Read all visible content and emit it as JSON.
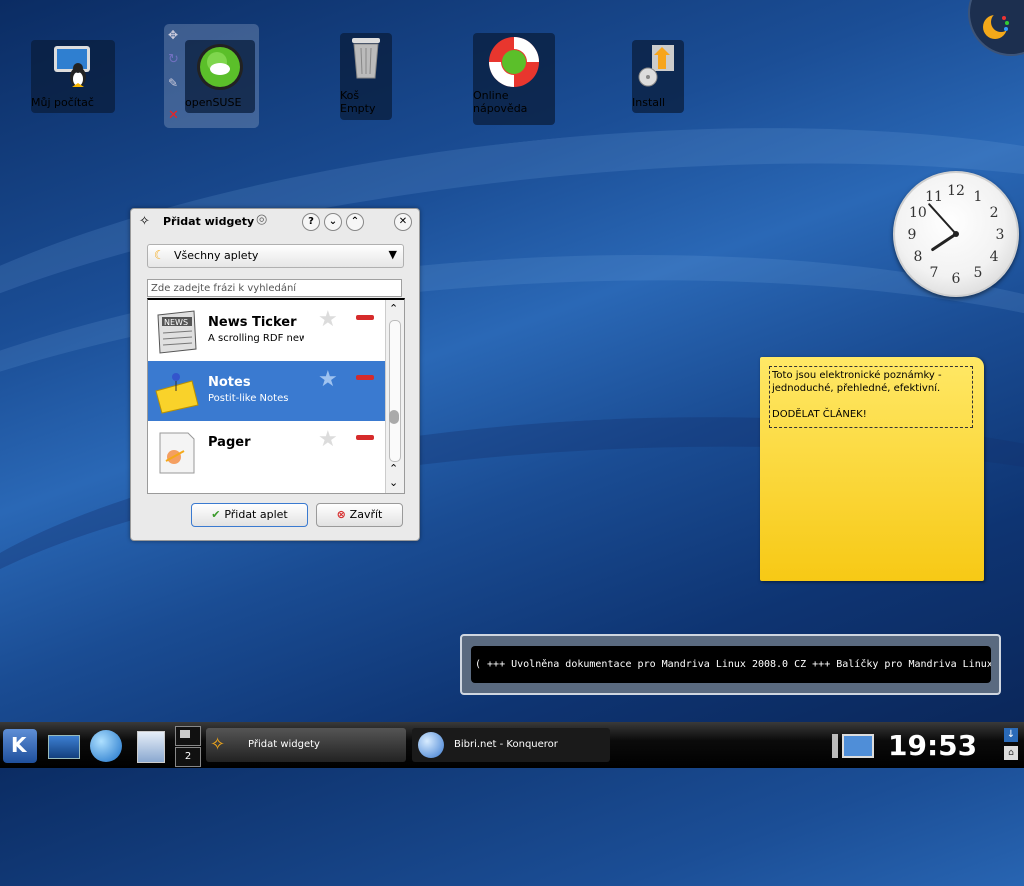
{
  "desktop_icons": [
    {
      "label": "Můj počítač",
      "icon": "my-computer-icon"
    },
    {
      "label": "openSUSE",
      "icon": "opensuse-icon"
    },
    {
      "label_line1": "Koš",
      "label_line2": "Empty",
      "icon": "trash-icon"
    },
    {
      "label_line1": "Online",
      "label_line2": "nápověda",
      "icon": "help-lifebuoy-icon"
    },
    {
      "label": "Install",
      "icon": "install-icon"
    }
  ],
  "dialog": {
    "title": "Přidat widgety",
    "category_selected": "Všechny aplety",
    "search_placeholder": "Zde zadejte frázi k vyhledání",
    "applets": [
      {
        "name": "News Ticker",
        "description": "A scrolling RDF news",
        "selected": false,
        "icon": "newspaper-icon"
      },
      {
        "name": "Notes",
        "description": "Postit-like Notes",
        "selected": true,
        "icon": "sticky-note-icon"
      },
      {
        "name": "Pager",
        "description": "",
        "selected": false,
        "icon": "pager-icon"
      }
    ],
    "add_button": "Přidat aplet",
    "close_button": "Zavřít"
  },
  "clock": {
    "numbers": [
      "12",
      "1",
      "2",
      "3",
      "4",
      "5",
      "6",
      "7",
      "8",
      "9",
      "10",
      "11"
    ],
    "hour": 19,
    "minute": 53
  },
  "note": {
    "text": "Toto jsou elektronické poznámky -\njednoduché, přehledné, efektivní.\n\nDODĚLAT ČLÁNEK!"
  },
  "ticker": {
    "text": "( +++ Uvolněna dokumentace pro Mandriva Linux 2008.0 CZ +++ Balíčky pro Mandriva Linux"
  },
  "taskbar": {
    "desktop_number": "2",
    "tasks": [
      {
        "label": "Přidat widgety",
        "active": true
      },
      {
        "label": "Bibri.net - Konqueror",
        "active": false
      }
    ],
    "time": "19:53"
  },
  "colors": {
    "selection": "#3a7ad0",
    "note_yellow": "#f9d22a",
    "taskbar": "#000000"
  }
}
